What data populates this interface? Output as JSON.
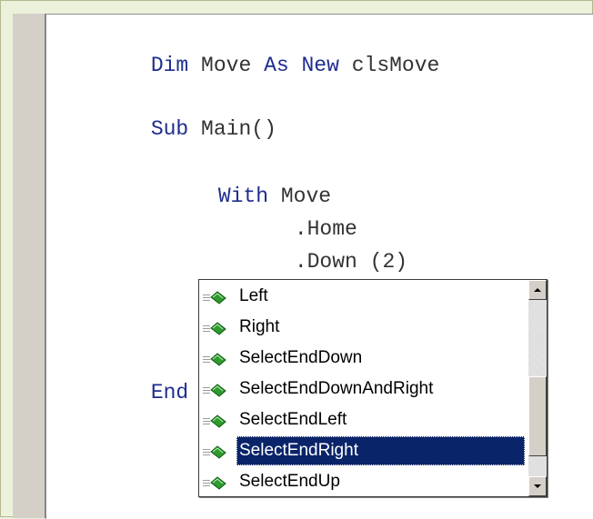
{
  "code": {
    "line1": {
      "kw1": "Dim",
      "t1": " Move ",
      "kw2": "As New",
      "t2": " clsMove"
    },
    "line2": {
      "kw1": "Sub",
      "t1": " Main()"
    },
    "line3": {
      "kw1": "With",
      "t1": " Move"
    },
    "line4": {
      "t1": ".Home"
    },
    "line5": {
      "t1": ".Down (2)"
    },
    "line6": {
      "t1": "."
    },
    "line7": {
      "kw1": "End Sub"
    }
  },
  "intellisense": {
    "items": [
      {
        "label": "Left",
        "icon": "method-icon"
      },
      {
        "label": "Right",
        "icon": "method-icon"
      },
      {
        "label": "SelectEndDown",
        "icon": "method-icon"
      },
      {
        "label": "SelectEndDownAndRight",
        "icon": "method-icon"
      },
      {
        "label": "SelectEndLeft",
        "icon": "method-icon"
      },
      {
        "label": "SelectEndRight",
        "icon": "method-icon",
        "selected": true
      },
      {
        "label": "SelectEndUp",
        "icon": "method-icon"
      }
    ],
    "selected_label": "SelectEndRight"
  },
  "colors": {
    "keyword": "#1f2d8f",
    "selection": "#0a246a",
    "method_icon": "#2f9a2f",
    "frame_background": "#ecf1dc",
    "gutter": "#d4d0c8"
  }
}
